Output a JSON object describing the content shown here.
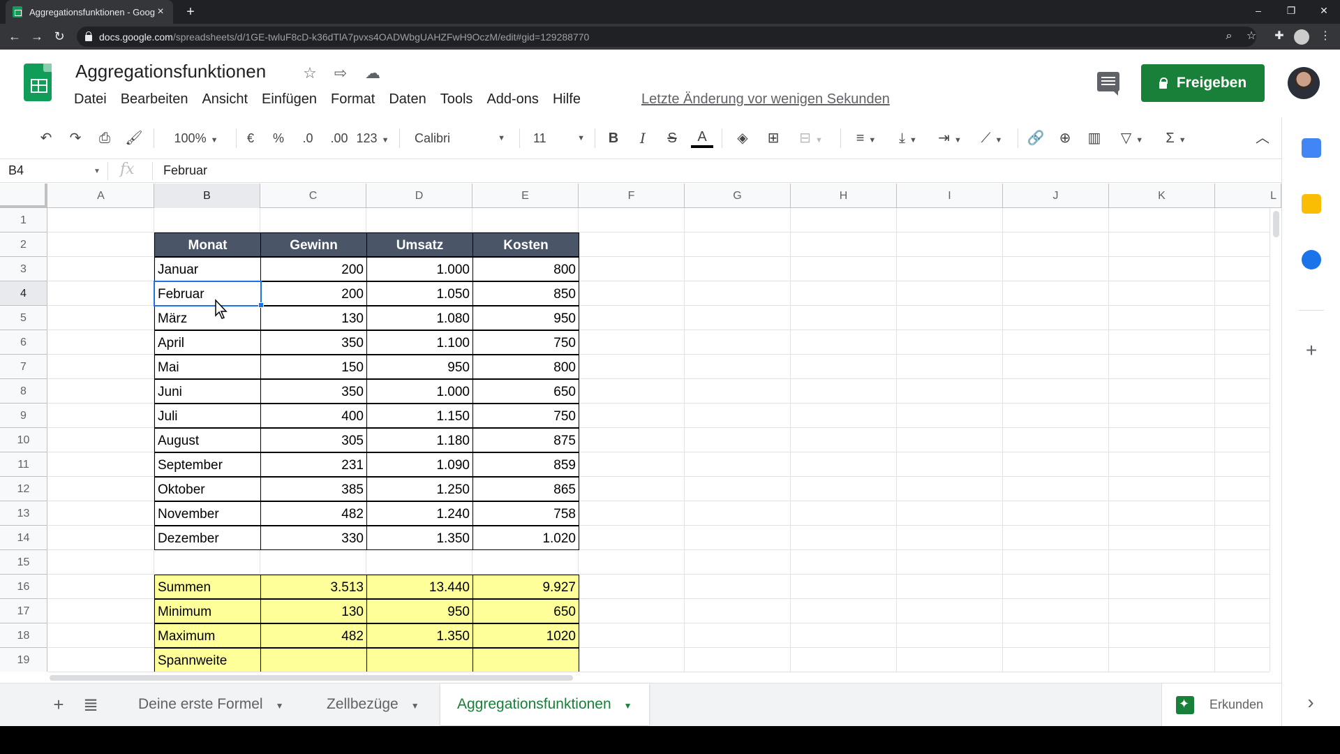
{
  "browser": {
    "tab_title": "Aggregationsfunktionen - Googl",
    "tab_close": "×",
    "new_tab": "+",
    "url_host": "docs.google.com",
    "url_path": "/spreadsheets/d/1GE-twluF8cD-k36dTlA7pvxs4OADWbgUAHZFwH9OczM/edit#gid=129288770",
    "window_controls": {
      "minimize": "–",
      "restore": "❐",
      "close": "✕"
    },
    "nav": {
      "back": "←",
      "forward": "→",
      "reload": "↻",
      "zoom": "⌕",
      "star": "☆",
      "extensions": "✚",
      "more": "⋮"
    }
  },
  "doc": {
    "title": "Aggregationsfunktionen",
    "last_edit": "Letzte Änderung vor wenigen Sekunden",
    "share_label": "Freigeben",
    "icons": {
      "star": "☆",
      "move": "⇨",
      "cloud": "☁"
    }
  },
  "menus": [
    "Datei",
    "Bearbeiten",
    "Ansicht",
    "Einfügen",
    "Format",
    "Daten",
    "Tools",
    "Add-ons",
    "Hilfe"
  ],
  "toolbar": {
    "zoom": "100%",
    "currency": "€",
    "percent": "%",
    "dec_decrease": ".0",
    "dec_increase": ".00",
    "more_formats": "123",
    "font": "Calibri",
    "font_size": "11",
    "bold": "B",
    "italic": "I",
    "strike": "S",
    "text_color": "A",
    "undo": "↶",
    "redo": "↷",
    "print": "⎙",
    "paint": "🖌",
    "fill": "◈",
    "borders": "⊞",
    "merge": "⊟",
    "halign": "≡",
    "valign": "⤓",
    "wrap": "⇥",
    "rotate": "⟋",
    "link": "🔗",
    "comment": "⊕",
    "chart": "▥",
    "filter": "▽",
    "functions": "Σ",
    "collapse": "︿"
  },
  "formula_bar": {
    "cell_ref": "B4",
    "fx": "fx",
    "value": "Februar"
  },
  "columns": [
    "A",
    "B",
    "C",
    "D",
    "E",
    "F",
    "G",
    "H",
    "I",
    "J",
    "K",
    "L"
  ],
  "rows": [
    "1",
    "2",
    "3",
    "4",
    "5",
    "6",
    "7",
    "8",
    "9",
    "10",
    "11",
    "12",
    "13",
    "14",
    "15",
    "16",
    "17",
    "18",
    "19"
  ],
  "table": {
    "headers": [
      "Monat",
      "Gewinn",
      "Umsatz",
      "Kosten"
    ],
    "rows": [
      [
        "Januar",
        "200",
        "1.000",
        "800"
      ],
      [
        "Februar",
        "200",
        "1.050",
        "850"
      ],
      [
        "März",
        "130",
        "1.080",
        "950"
      ],
      [
        "April",
        "350",
        "1.100",
        "750"
      ],
      [
        "Mai",
        "150",
        "950",
        "800"
      ],
      [
        "Juni",
        "350",
        "1.000",
        "650"
      ],
      [
        "Juli",
        "400",
        "1.150",
        "750"
      ],
      [
        "August",
        "305",
        "1.180",
        "875"
      ],
      [
        "September",
        "231",
        "1.090",
        "859"
      ],
      [
        "Oktober",
        "385",
        "1.250",
        "865"
      ],
      [
        "November",
        "482",
        "1.240",
        "758"
      ],
      [
        "Dezember",
        "330",
        "1.350",
        "1.020"
      ]
    ]
  },
  "summary": {
    "rows": [
      [
        "Summen",
        "3.513",
        "13.440",
        "9.927"
      ],
      [
        "Minimum",
        "130",
        "950",
        "650"
      ],
      [
        "Maximum",
        "482",
        "1.350",
        "1020"
      ],
      [
        "Spannweite",
        "",
        "",
        ""
      ]
    ]
  },
  "sheets": {
    "add": "+",
    "all": "≣",
    "tabs": [
      {
        "label": "Deine erste Formel",
        "active": false
      },
      {
        "label": "Zellbezüge",
        "active": false
      },
      {
        "label": "Aggregationsfunktionen",
        "active": true
      }
    ],
    "explore": "Erkunden",
    "panel_toggle": "›"
  },
  "colors": {
    "header_bg": "#4a5568",
    "summary_bg": "#ffff99",
    "accent_green": "#188038",
    "selection_blue": "#1a73e8"
  }
}
